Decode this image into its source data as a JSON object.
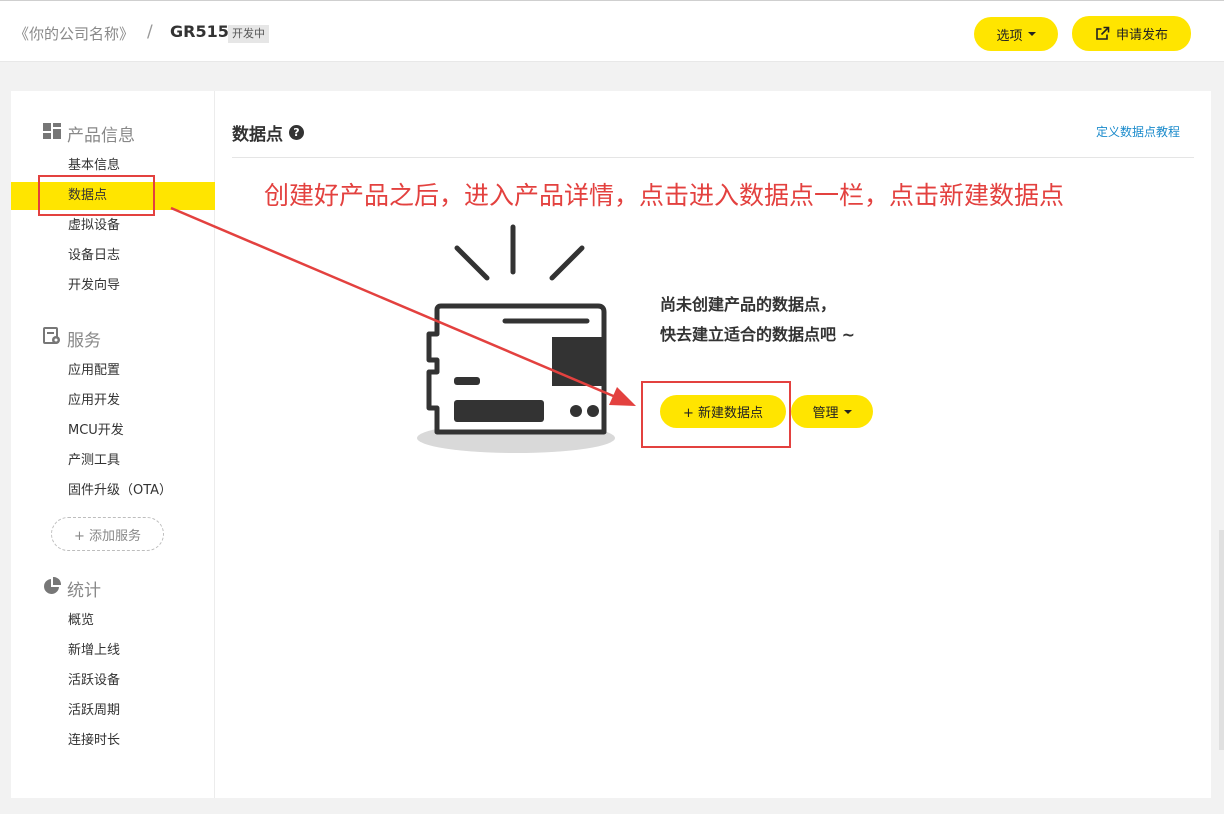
{
  "breadcrumb": {
    "company": "《你的公司名称》",
    "separator": "/",
    "product": "GR515",
    "status_badge": "开发中"
  },
  "header": {
    "options_label": "选项",
    "publish_label": "申请发布"
  },
  "sidebar": {
    "sections": [
      {
        "title": "产品信息",
        "icon": "dashboard-icon",
        "items": [
          "基本信息",
          "数据点",
          "虚拟设备",
          "设备日志",
          "开发向导"
        ]
      },
      {
        "title": "服务",
        "icon": "service-gear-icon",
        "items": [
          "应用配置",
          "应用开发",
          "MCU开发",
          "产测工具",
          "固件升级（OTA）"
        ]
      },
      {
        "title": "统计",
        "icon": "pie-chart-icon",
        "items": [
          "概览",
          "新增上线",
          "活跃设备",
          "活跃周期",
          "连接时长"
        ]
      }
    ],
    "active_item": "数据点",
    "add_service_label": "+ 添加服务"
  },
  "content": {
    "title": "数据点",
    "tutorial_link": "定义数据点教程",
    "annotation": "创建好产品之后，进入产品详情，点击进入数据点一栏，点击新建数据点",
    "empty_line1": "尚未创建产品的数据点，",
    "empty_line2": "快去建立适合的数据点吧 ~",
    "new_button_label": "+ 新建数据点",
    "manage_button_label": "管理"
  },
  "colors": {
    "accent_yellow": "#ffe500",
    "annotation_red": "#e3413f",
    "link_blue": "#1a8acb",
    "illustration_dark": "#333333"
  }
}
